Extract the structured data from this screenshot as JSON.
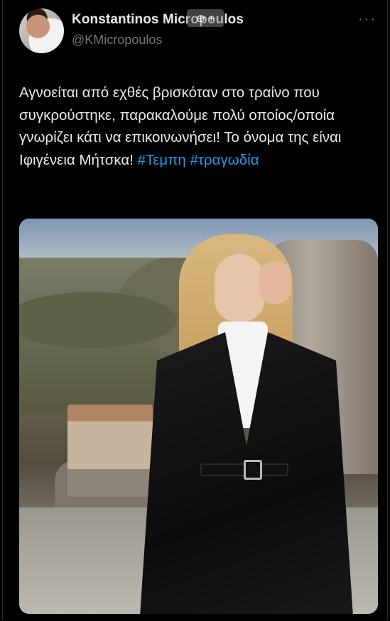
{
  "tweet": {
    "author_name": "Konstantinos Micropoulos",
    "author_handle": "@KMicropoulos",
    "more_label": "···",
    "zoom_label": "⊕ +",
    "text_segments": [
      {
        "type": "text",
        "value": "Αγνοείται από εχθές βρισκόταν στο τραίνο που συγκρούστηκε, παρακαλούμε πολύ οποίος/οποία γνωρίζει κάτι να επικοινωνήσει! Το όνομα της είναι Ιφιγένεια Μήτσκα! "
      },
      {
        "type": "hashtag",
        "value": "#Τεμπη"
      },
      {
        "type": "text",
        "value": " "
      },
      {
        "type": "hashtag",
        "value": "#τραγωδία"
      }
    ]
  },
  "icons": {
    "avatar": "profile-photo",
    "more": "more-options-icon",
    "zoom": "zoom-in-icon"
  },
  "colors": {
    "background": "#000000",
    "text": "#e7e9ea",
    "secondary": "#71767b",
    "hashtag": "#1d9bf0"
  }
}
